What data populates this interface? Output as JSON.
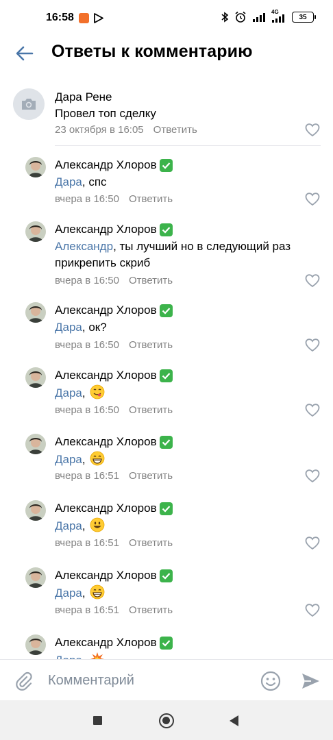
{
  "status_bar": {
    "time": "16:58",
    "network": "4G",
    "battery": "35"
  },
  "header": {
    "title": "Ответы к комментарию"
  },
  "root_comment": {
    "author": "Дара Рене",
    "text": "Провел топ сделку",
    "date": "23 октября в 16:05",
    "reply_label": "Ответить"
  },
  "replies": [
    {
      "author": "Александр Хлоров",
      "mention": "Дара",
      "text": ", спс",
      "date": "вчера в 16:50",
      "reply_label": "Ответить"
    },
    {
      "author": "Александр Хлоров",
      "mention": "Александр",
      "text": ", ты лучший но в следующий раз прикрепить скриб",
      "date": "вчера в 16:50",
      "reply_label": "Ответить"
    },
    {
      "author": "Александр Хлоров",
      "mention": "Дара",
      "text": ", ок?",
      "date": "вчера в 16:50",
      "reply_label": "Ответить"
    },
    {
      "author": "Александр Хлоров",
      "mention": "Дара",
      "text": ", ",
      "emoji": "savoring-face",
      "date": "вчера в 16:50",
      "reply_label": "Ответить"
    },
    {
      "author": "Александр Хлоров",
      "mention": "Дара",
      "text": ", ",
      "emoji": "grinning-face",
      "date": "вчера в 16:51",
      "reply_label": "Ответить"
    },
    {
      "author": "Александр Хлоров",
      "mention": "Дара",
      "text": ", ",
      "emoji": "smiling-face",
      "date": "вчера в 16:51",
      "reply_label": "Ответить"
    },
    {
      "author": "Александр Хлоров",
      "mention": "Дара",
      "text": ", ",
      "emoji": "grinning-face",
      "date": "вчера в 16:51",
      "reply_label": "Ответить"
    },
    {
      "author": "Александр Хлоров",
      "mention": "Дара",
      "text": ", ",
      "emoji": "collision",
      "date": "",
      "reply_label": ""
    }
  ],
  "input": {
    "placeholder": "Комментарий"
  },
  "colors": {
    "accent": "#4a76a8",
    "meta": "#828282",
    "verified": "#3cb34b"
  }
}
